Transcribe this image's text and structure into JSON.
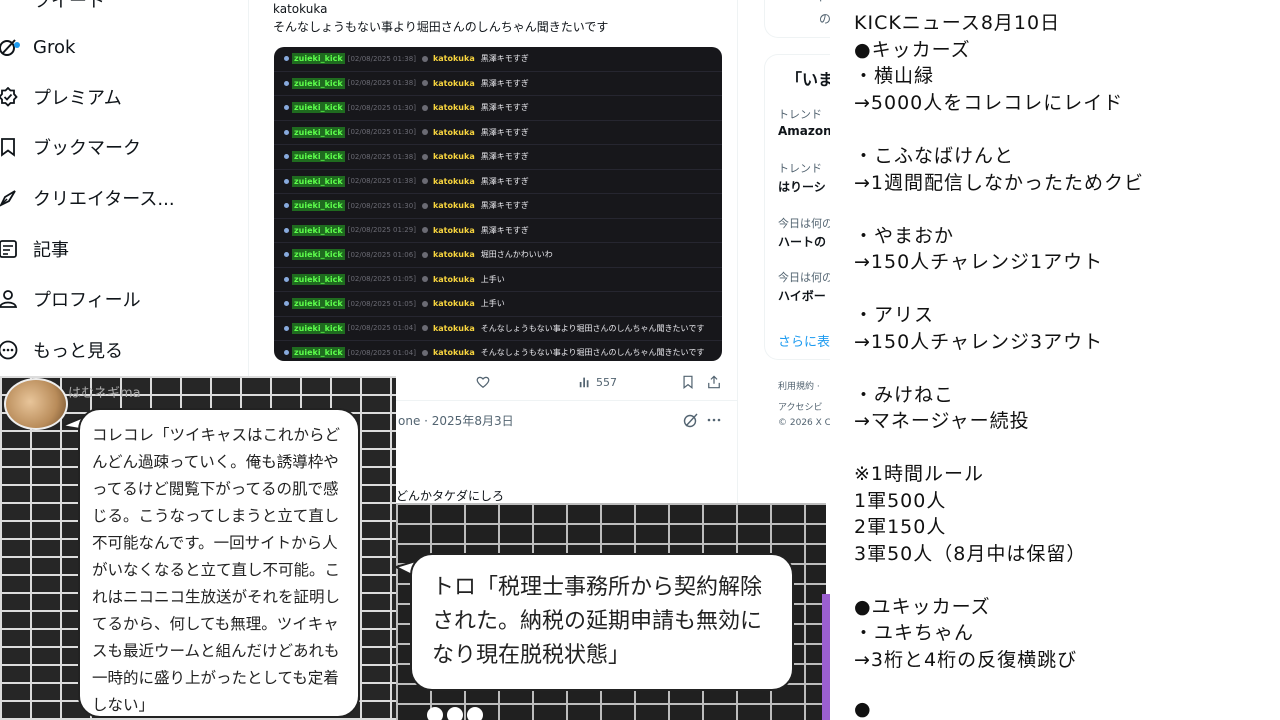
{
  "sidebar": {
    "items": [
      {
        "label": "ツイート",
        "icon": "partial-icon"
      },
      {
        "label": "Grok",
        "icon": "grok-icon"
      },
      {
        "label": "プレミアム",
        "icon": "premium-icon"
      },
      {
        "label": "ブックマーク",
        "icon": "bookmark-icon"
      },
      {
        "label": "クリエイタース...",
        "icon": "creator-studio-icon"
      },
      {
        "label": "記事",
        "icon": "article-icon"
      },
      {
        "label": "プロフィール",
        "icon": "profile-icon"
      },
      {
        "label": "もっと見る",
        "icon": "more-icon"
      }
    ]
  },
  "tweet": {
    "author": "katokuka",
    "text": "そんなしょうもない事より堀田さんのしんちゃん聞きたいです",
    "views": "557",
    "chat": [
      {
        "user": "zuieki_kick",
        "time": "[02/08/2025 01:38]",
        "reply_user": "katokuka",
        "message": "黒澤キモすぎ"
      },
      {
        "user": "zuieki_kick",
        "time": "[02/08/2025 01:38]",
        "reply_user": "katokuka",
        "message": "黒澤キモすぎ"
      },
      {
        "user": "zuieki_kick",
        "time": "[02/08/2025 01:30]",
        "reply_user": "katokuka",
        "message": "黒澤キモすぎ"
      },
      {
        "user": "zuieki_kick",
        "time": "[02/08/2025 01:30]",
        "reply_user": "katokuka",
        "message": "黒澤キモすぎ"
      },
      {
        "user": "zuieki_kick",
        "time": "[02/08/2025 01:38]",
        "reply_user": "katokuka",
        "message": "黒澤キモすぎ"
      },
      {
        "user": "zuieki_kick",
        "time": "[02/08/2025 01:38]",
        "reply_user": "katokuka",
        "message": "黒澤キモすぎ"
      },
      {
        "user": "zuieki_kick",
        "time": "[02/08/2025 01:30]",
        "reply_user": "katokuka",
        "message": "黒澤キモすぎ"
      },
      {
        "user": "zuieki_kick",
        "time": "[02/08/2025 01:29]",
        "reply_user": "katokuka",
        "message": "黒澤キモすぎ"
      },
      {
        "user": "zuieki_kick",
        "time": "[02/08/2025 01:06]",
        "reply_user": "katokuka",
        "message": "堀田さんかわいいわ"
      },
      {
        "user": "zuieki_kick",
        "time": "[02/08/2025 01:05]",
        "reply_user": "katokuka",
        "message": "上手い"
      },
      {
        "user": "zuieki_kick",
        "time": "[02/08/2025 01:05]",
        "reply_user": "katokuka",
        "message": "上手い"
      },
      {
        "user": "zuieki_kick",
        "time": "[02/08/2025 01:04]",
        "reply_user": "katokuka",
        "message": "そんなしょうもない事より堀田さんのしんちゃん聞きたいです"
      },
      {
        "user": "zuieki_kick",
        "time": "[02/08/2025 01:04]",
        "reply_user": "katokuka",
        "message": "そんなしょうもない事より堀田さんのしんちゃん聞きたいです"
      }
    ]
  },
  "tweet2": {
    "meta": "one · 2025年8月3日",
    "text": "どんかタケダにしろ"
  },
  "trends": {
    "top_partial": "の",
    "title": "「いま",
    "items": [
      {
        "category": "トレンド",
        "name": "Amazon"
      },
      {
        "category": "トレンド",
        "name": "はりーシ"
      },
      {
        "category": "今日は何の",
        "name": "ハートの"
      },
      {
        "category": "今日は何の",
        "name": "ハイボー"
      }
    ],
    "show_more": "さらに表",
    "footer": [
      "利用規約 ·",
      "アクセシビ",
      "© 2026 X Co"
    ]
  },
  "news": {
    "lines": [
      "KICKニュース8月10日",
      "●キッカーズ",
      "・横山緑",
      "→5000人をコレコレにレイド",
      "・こふなばけんと",
      "→1週間配信しなかったためクビ",
      "・やまおか",
      "→150人チャレンジ1アウト",
      "・アリス",
      "→150人チャレンジ3アウト",
      "・みけねこ",
      "→マネージャー続投",
      "※1時間ルール",
      "1軍500人",
      "2軍150人",
      "3軍50人（8月中は保留）",
      "●ユキッカーズ",
      "・ユキちゃん",
      "→3桁と4桁の反復横跳び",
      "●"
    ]
  },
  "comicA": {
    "name": "はむネギma",
    "text": "コレコレ「ツイキャスはこれからどんどん過疎っていく。俺も誘導枠やってるけど閲覧下がってるの肌で感じる。こうなってしまうと立て直し不可能なんです。一回サイトから人がいなくなると立て直し不可能。これはニコニコ生放送がそれを証明してるから、何しても無理。ツイキャスも最近ウームと組んだけどあれも一時的に盛り上がったとしても定着しない」"
  },
  "comicB": {
    "text": "トロ「税理士事務所から契約解除された。納税の延期申請も無効になり現在脱税状態」"
  }
}
